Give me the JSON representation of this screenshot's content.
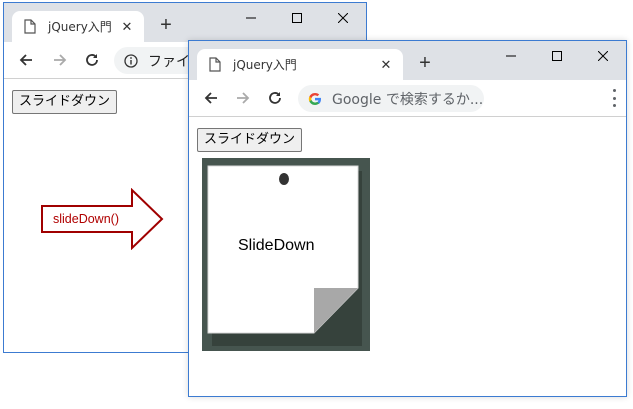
{
  "back_window": {
    "tab_title": "jQuery入門",
    "address_text": "ファイル",
    "button_label": "スライドダウン"
  },
  "front_window": {
    "tab_title": "jQuery入門",
    "address_placeholder": "Google で検索するか...",
    "button_label": "スライドダウン",
    "note_text": "SlideDown"
  },
  "annotation": {
    "label": "slideDown()",
    "color": "#a00000"
  },
  "icons": [
    "page-icon",
    "close-icon",
    "new-tab-icon",
    "minimize-icon",
    "maximize-icon",
    "window-close-icon",
    "back-icon",
    "forward-icon",
    "reload-icon",
    "info-icon",
    "google-icon",
    "menu-icon",
    "arrow-icon"
  ]
}
